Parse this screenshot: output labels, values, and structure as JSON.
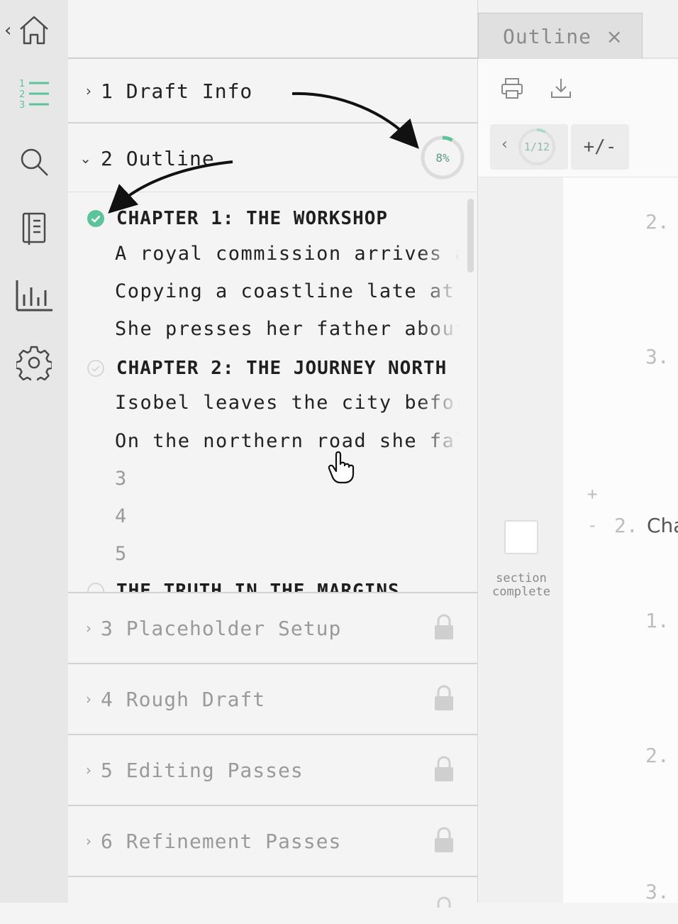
{
  "colors": {
    "accent": "#5cc39a",
    "rail_bg": "#e7e7e7",
    "panel_bg": "#f4f4f4",
    "locked_text": "#9a9a9a"
  },
  "rail": {
    "back_glyph": "‹",
    "icons": [
      "home-icon",
      "numbered-list-icon",
      "search-icon",
      "notebook-icon",
      "bar-chart-icon",
      "gear-icon"
    ]
  },
  "sections": [
    {
      "number": "1",
      "title": "Draft Info",
      "expanded": false,
      "locked": false
    },
    {
      "number": "2",
      "title": "Outline",
      "expanded": true,
      "locked": false,
      "progress": "8%"
    },
    {
      "number": "3",
      "title": "Placeholder Setup",
      "expanded": false,
      "locked": true
    },
    {
      "number": "4",
      "title": "Rough Draft",
      "expanded": false,
      "locked": true
    },
    {
      "number": "5",
      "title": "Editing Passes",
      "expanded": false,
      "locked": true
    },
    {
      "number": "6",
      "title": "Refinement Passes",
      "expanded": false,
      "locked": true
    }
  ],
  "outline": {
    "chapters": [
      {
        "title": "CHAPTER 1: THE WORKSHOP",
        "complete": true,
        "scenes": [
          "A royal commission arrives at",
          "Copying a coastline late at night",
          "She presses her father about"
        ]
      },
      {
        "title": "CHAPTER 2: THE JOURNEY NORTH",
        "complete": false,
        "scenes": [
          "Isobel leaves the city before",
          "On the northern road she falls",
          "3",
          "4",
          "5"
        ]
      },
      {
        "title": "THE TRUTH IN THE MARGINS",
        "complete": false,
        "scenes": []
      }
    ]
  },
  "editor": {
    "tab_label": "Outline",
    "tab_close": "×",
    "nav_prev": "‹",
    "nav_position": "1/12",
    "expand_collapse": "+/-",
    "section_complete_label": "section complete",
    "lines": {
      "l1": "2.",
      "l2": "3.",
      "plus": "+",
      "minus": "-",
      "l3": "2.",
      "l3_text": "Cha",
      "l4": "1.",
      "l5": "2.",
      "l6": "3."
    }
  }
}
